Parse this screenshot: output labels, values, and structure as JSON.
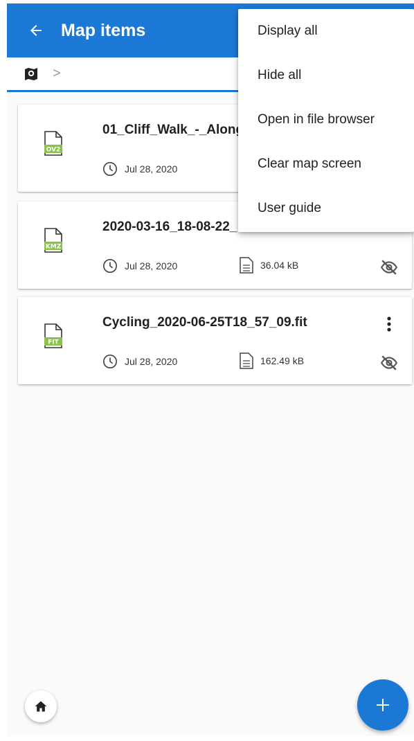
{
  "appbar": {
    "title": "Map items",
    "back_icon": "arrow-left-icon"
  },
  "breadcrumb": {
    "root_icon": "map-folder-icon",
    "separator": ">"
  },
  "files": [
    {
      "name": "01_Cliff_Walk_-_Along",
      "badge": "OV2",
      "badge_color": "#8bc34a",
      "date": "Jul 28, 2020",
      "size": "",
      "visibility_icon": "eye-off-icon"
    },
    {
      "name": "2020-03-16_18-08-22_",
      "badge": "KMZ",
      "badge_color": "#8bc34a",
      "date": "Jul 28, 2020",
      "size": "36.04 kB",
      "visibility_icon": "eye-off-icon"
    },
    {
      "name": "Cycling_2020-06-25T18_57_09.fit",
      "badge": "FIT",
      "badge_color": "#8bc34a",
      "date": "Jul 28, 2020",
      "size": "162.49 kB",
      "visibility_icon": "eye-off-icon"
    }
  ],
  "menu": {
    "items": [
      {
        "label": "Display all"
      },
      {
        "label": "Hide all"
      },
      {
        "label": "Open in file browser"
      },
      {
        "label": "Clear map screen"
      },
      {
        "label": "User guide"
      }
    ]
  },
  "bottom": {
    "home_icon": "home-icon",
    "fab_icon": "plus-icon"
  },
  "colors": {
    "primary": "#1b78d4",
    "accent_file": "#8bc34a"
  }
}
